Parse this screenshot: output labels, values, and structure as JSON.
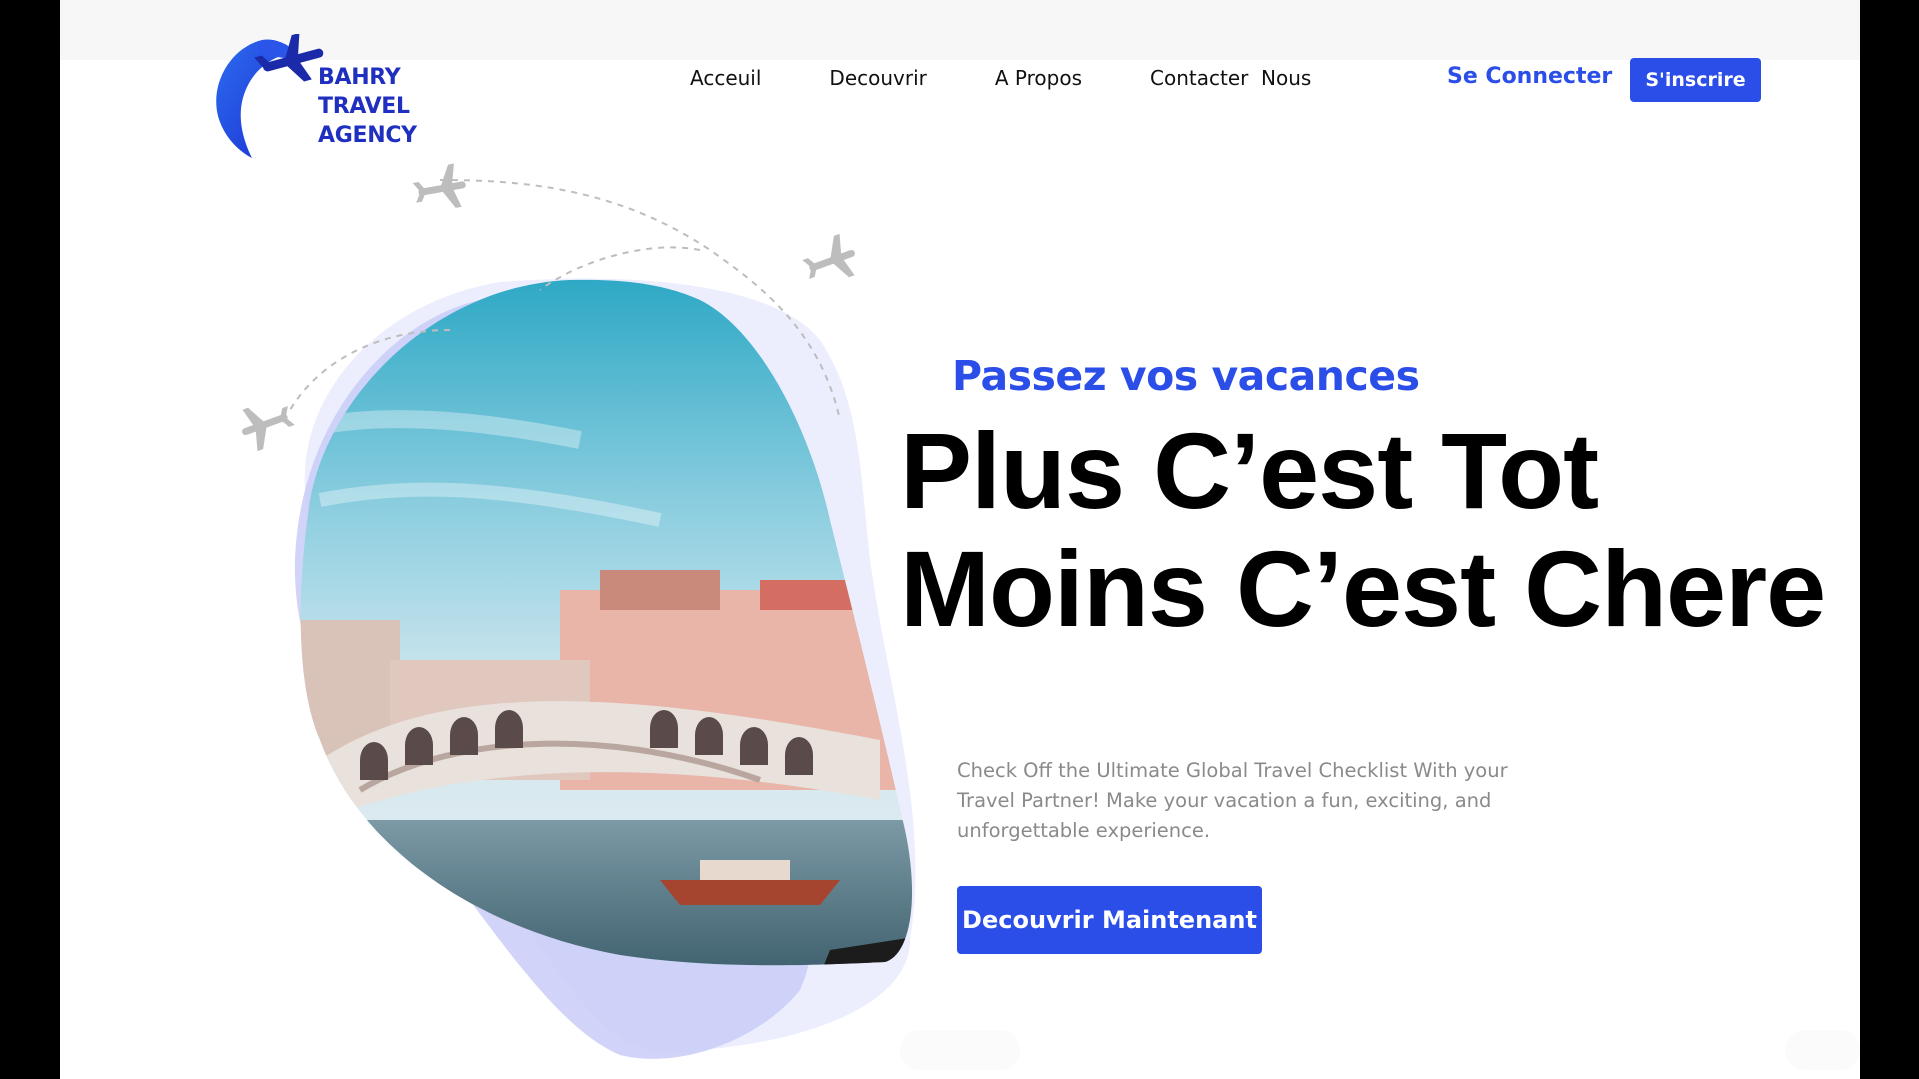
{
  "brand": {
    "name_lines": [
      "BAHRY",
      "TRAVEL",
      "AGENCY"
    ],
    "color": "#1f2fbf"
  },
  "nav": {
    "items": [
      "Acceuil",
      "Decouvrir",
      "A Propos",
      "Contacter  Nous"
    ],
    "login": "Se Connecter",
    "signup": "S'inscrire"
  },
  "hero": {
    "kicker": "Passez vos vacances",
    "headline_line1": "Plus C’est Tot",
    "headline_line2": "Moins C’est Chere",
    "description": "Check Off the Ultimate Global Travel Checklist With your Travel Partner! Make your vacation a fun, exciting, and unforgettable experience.",
    "cta": "Decouvrir Maintenant",
    "image": "venice-rialto-bridge-photo"
  },
  "colors": {
    "accent": "#2b4de8",
    "text": "#000000",
    "muted": "#8a8a8a",
    "blob": "#c9cdf7"
  }
}
